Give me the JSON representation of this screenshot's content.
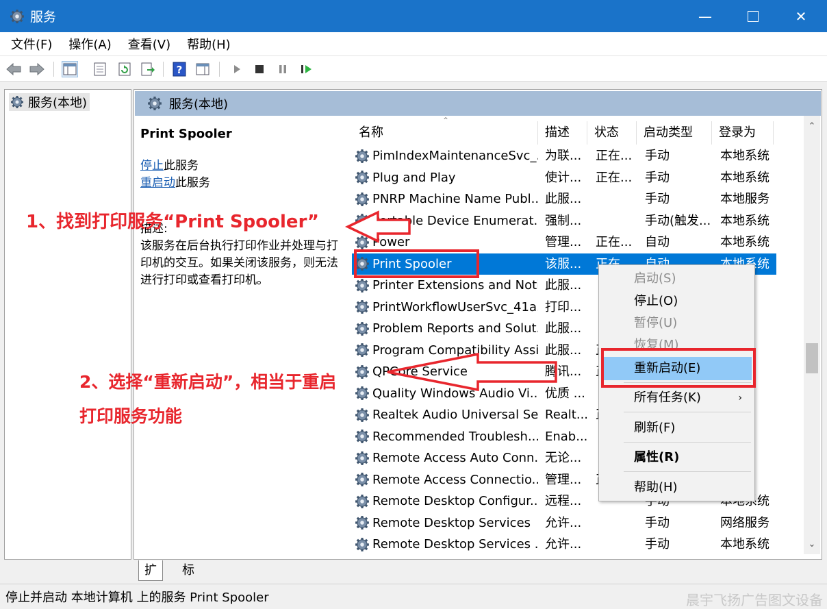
{
  "window": {
    "title": "服务"
  },
  "menubar": {
    "items": [
      "文件(F)",
      "操作(A)",
      "查看(V)",
      "帮助(H)"
    ]
  },
  "tree": {
    "root_label": "服务(本地)"
  },
  "pane": {
    "header": "服务(本地)"
  },
  "description": {
    "service_name": "Print Spooler",
    "stop_link": "停止",
    "stop_suffix": "此服务",
    "restart_link": "重启动",
    "restart_suffix": "此服务",
    "label": "描述:",
    "text": "该服务在后台执行打印作业并处理与打印机的交互。如果关闭该服务，则无法进行打印或查看打印机。"
  },
  "columns": {
    "name": "名称",
    "desc": "描述",
    "status": "状态",
    "startup": "启动类型",
    "logon": "登录为"
  },
  "rows": [
    {
      "name": "PimIndexMaintenanceSvc_...",
      "desc": "为联...",
      "status": "正在...",
      "startup": "手动",
      "logon": "本地系统"
    },
    {
      "name": "Plug and Play",
      "desc": "使计...",
      "status": "正在...",
      "startup": "手动",
      "logon": "本地系统"
    },
    {
      "name": "PNRP Machine Name Publ...",
      "desc": "此服...",
      "status": "",
      "startup": "手动",
      "logon": "本地服务"
    },
    {
      "name": "Portable Device Enumerat...",
      "desc": "强制...",
      "status": "",
      "startup": "手动(触发...",
      "logon": "本地系统"
    },
    {
      "name": "Power",
      "desc": "管理...",
      "status": "正在...",
      "startup": "自动",
      "logon": "本地系统"
    },
    {
      "name": "Print Spooler",
      "desc": "该服...",
      "status": "正在...",
      "startup": "自动",
      "logon": "本地系统"
    },
    {
      "name": "Printer Extensions and Noti...",
      "desc": "此服...",
      "status": "",
      "startup": "",
      "logon": "统"
    },
    {
      "name": "PrintWorkflowUserSvc_41a...",
      "desc": "打印...",
      "status": "",
      "startup": "",
      "logon": "统"
    },
    {
      "name": "Problem Reports and Solut...",
      "desc": "此服...",
      "status": "",
      "startup": "",
      "logon": "统"
    },
    {
      "name": "Program Compatibility Assi...",
      "desc": "此服...",
      "status": "正",
      "startup": "",
      "logon": "统"
    },
    {
      "name": "QPCore Service",
      "desc": "腾讯...",
      "status": "正",
      "startup": "",
      "logon": "统"
    },
    {
      "name": "Quality Windows Audio Vi...",
      "desc": "优质 ...",
      "status": "",
      "startup": "",
      "logon": "务"
    },
    {
      "name": "Realtek Audio Universal Se...",
      "desc": "Realt...",
      "status": "正",
      "startup": "",
      "logon": "统"
    },
    {
      "name": "Recommended Troublesh...",
      "desc": "Enab...",
      "status": "",
      "startup": "",
      "logon": "统"
    },
    {
      "name": "Remote Access Auto Conn...",
      "desc": "无论...",
      "status": "",
      "startup": "",
      "logon": "统"
    },
    {
      "name": "Remote Access Connectio...",
      "desc": "管理...",
      "status": "正",
      "startup": "",
      "logon": "统"
    },
    {
      "name": "Remote Desktop Configur...",
      "desc": "远程...",
      "status": "",
      "startup": "手动",
      "logon": "本地系统"
    },
    {
      "name": "Remote Desktop Services",
      "desc": "允许...",
      "status": "",
      "startup": "手动",
      "logon": "网络服务"
    },
    {
      "name": "Remote Desktop Services ...",
      "desc": "允许...",
      "status": "",
      "startup": "手动",
      "logon": "本地系统"
    }
  ],
  "context_menu": {
    "start": "启动(S)",
    "stop": "停止(O)",
    "pause": "暂停(U)",
    "resume": "恢复(M)",
    "restart": "重新启动(E)",
    "all_tasks": "所有任务(K)",
    "refresh": "刷新(F)",
    "properties": "属性(R)",
    "help": "帮助(H)"
  },
  "tabs": {
    "extended": "扩展",
    "standard": "标准"
  },
  "statusbar": {
    "text": "停止并启动 本地计算机 上的服务 Print Spooler"
  },
  "watermark": "晨宇飞扬广告图文设备",
  "annotations": {
    "step1": "1、找到打印服务“Print Spooler”",
    "step2_line1": "2、选择“重新启动”，相当于重启",
    "step2_line2": "打印服务功能"
  },
  "colors": {
    "titlebar": "#1a73c9",
    "selection": "#0078d7",
    "menu_highlight": "#91c9f7",
    "annotation": "#e8262d",
    "pane_header": "#a6bdd7"
  },
  "icons": [
    "services-app-icon",
    "minimize-icon",
    "maximize-icon",
    "close-icon",
    "back-icon",
    "forward-icon",
    "service-gear-icon"
  ]
}
